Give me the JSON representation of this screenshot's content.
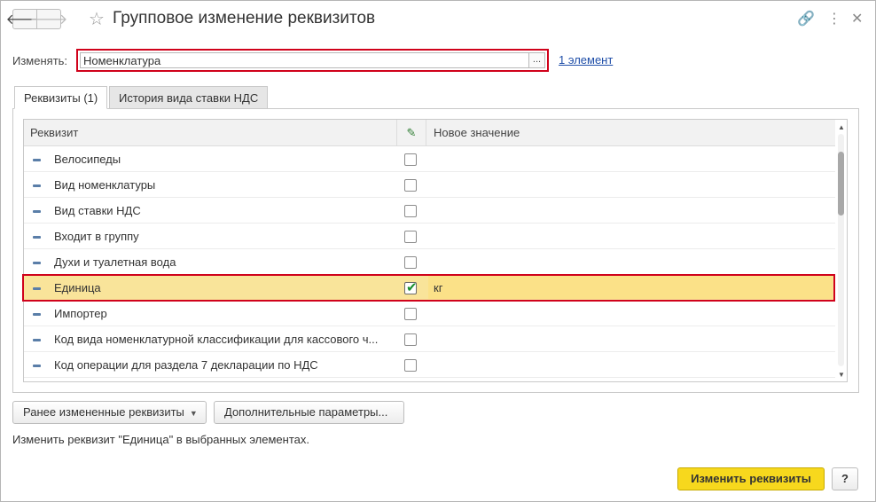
{
  "window": {
    "title": "Групповое изменение реквизитов",
    "nav_back": "🡐",
    "nav_forward": "🡒",
    "star": "☆",
    "link_icon": "🔗",
    "more_icon": "⋮",
    "close_icon": "✕"
  },
  "edit": {
    "label": "Изменять:",
    "value": "Номенклатура",
    "select_button": "...",
    "elements_link": "1 элемент"
  },
  "tabs": [
    {
      "label": "Реквизиты (1)",
      "active": true
    },
    {
      "label": "История вида ставки НДС",
      "active": false
    }
  ],
  "table": {
    "columns": {
      "name": "Реквизит",
      "value": "Новое значение",
      "pencil": "✎"
    },
    "rows": [
      {
        "name": "Велосипеды",
        "checked": false,
        "value": ""
      },
      {
        "name": "Вид номенклатуры",
        "checked": false,
        "value": ""
      },
      {
        "name": "Вид ставки НДС",
        "checked": false,
        "value": ""
      },
      {
        "name": "Входит в группу",
        "checked": false,
        "value": ""
      },
      {
        "name": "Духи и туалетная вода",
        "checked": false,
        "value": ""
      },
      {
        "name": "Единица",
        "checked": true,
        "value": "кг"
      },
      {
        "name": "Импортер",
        "checked": false,
        "value": ""
      },
      {
        "name": "Код вида номенклатурной классификации для кассового ч...",
        "checked": false,
        "value": ""
      },
      {
        "name": "Код операции для раздела 7 декларации по НДС",
        "checked": false,
        "value": ""
      }
    ],
    "check_mark": "✔",
    "scroll_up": "▲",
    "scroll_down": "▼"
  },
  "buttons": {
    "previous": "Ранее измененные реквизиты",
    "previous_arrow": "▼",
    "extra": "Дополнительные параметры...",
    "apply": "Изменить реквизиты",
    "help": "?"
  },
  "hint": "Изменить реквизит \"Единица\" в выбранных элементах.",
  "colors": {
    "accent_button": "#f7d81d",
    "selection": "#f9e49a",
    "highlight_frame": "#d0021b"
  }
}
